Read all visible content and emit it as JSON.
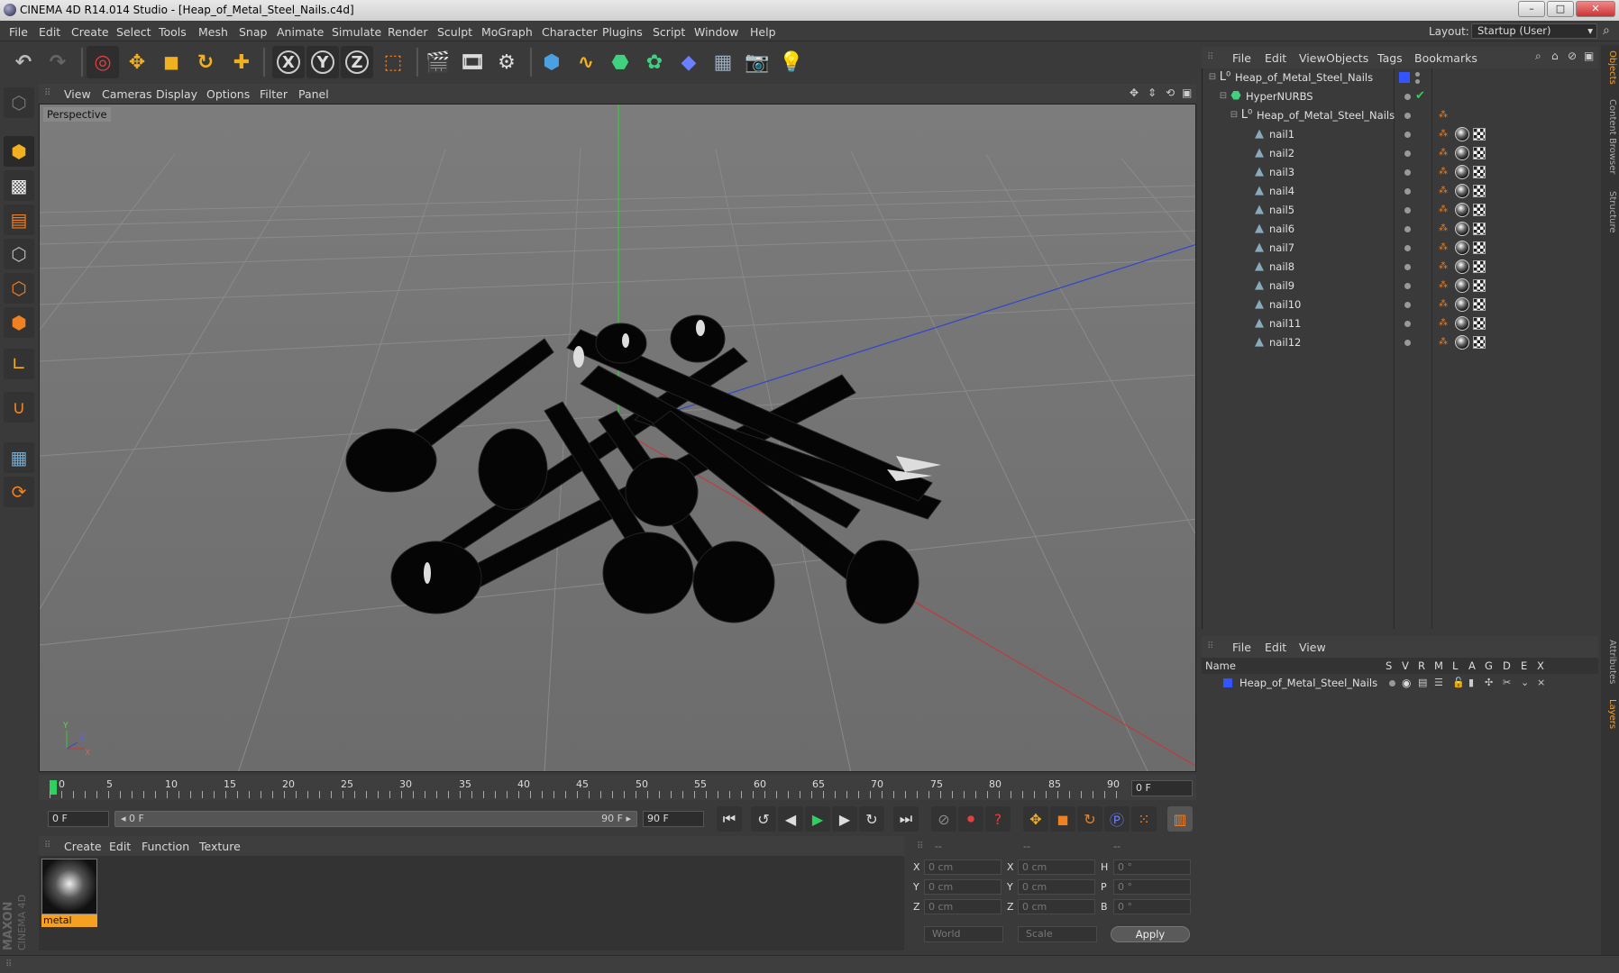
{
  "window": {
    "title": "CINEMA 4D R14.014 Studio - [Heap_of_Metal_Steel_Nails.c4d]",
    "min": "–",
    "max": "□",
    "close": "✕"
  },
  "menubar": {
    "items": [
      "File",
      "Edit",
      "Create",
      "Select",
      "Tools",
      "Mesh",
      "Snap",
      "Animate",
      "Simulate",
      "Render",
      "Sculpt",
      "MoGraph",
      "Character",
      "Plugins",
      "Script",
      "Window",
      "Help"
    ],
    "layout_label": "Layout:",
    "layout_value": "Startup (User)"
  },
  "toolbar": {
    "axis_x": "X",
    "axis_y": "Y",
    "axis_z": "Z"
  },
  "viewport": {
    "menu": [
      "View",
      "Cameras",
      "Display",
      "Options",
      "Filter",
      "Panel"
    ],
    "label": "Perspective"
  },
  "timeline": {
    "ticks": [
      "0",
      "5",
      "10",
      "15",
      "20",
      "25",
      "30",
      "35",
      "40",
      "45",
      "50",
      "55",
      "60",
      "65",
      "70",
      "75",
      "80",
      "85",
      "90"
    ],
    "current_frame": "0 F"
  },
  "transport": {
    "start_field": "0 F",
    "range_start": "◂ 0 F",
    "range_end": "90 F ▸",
    "end_field": "90 F"
  },
  "materials": {
    "menu": [
      "Create",
      "Edit",
      "Function",
      "Texture"
    ],
    "items": [
      {
        "name": "metal"
      }
    ]
  },
  "coordinates": {
    "headers": [
      "--",
      "--",
      "--"
    ],
    "rows": [
      {
        "a": "X",
        "av": "0 cm",
        "b": "X",
        "bv": "0 cm",
        "c": "H",
        "cv": "0 °"
      },
      {
        "a": "Y",
        "av": "0 cm",
        "b": "Y",
        "bv": "0 cm",
        "c": "P",
        "cv": "0 °"
      },
      {
        "a": "Z",
        "av": "0 cm",
        "b": "Z",
        "bv": "0 cm",
        "c": "B",
        "cv": "0 °"
      }
    ],
    "space": "World",
    "mode": "Scale",
    "apply": "Apply"
  },
  "object_manager": {
    "menu": [
      "File",
      "Edit",
      "View",
      "Objects",
      "Tags",
      "Bookmarks"
    ],
    "root": "Heap_of_Metal_Steel_Nails",
    "nurbs": "HyperNURBS",
    "group": "Heap_of_Metal_Steel_Nails",
    "nails": [
      "nail1",
      "nail2",
      "nail3",
      "nail4",
      "nail5",
      "nail6",
      "nail7",
      "nail8",
      "nail9",
      "nail10",
      "nail11",
      "nail12"
    ]
  },
  "layer_manager": {
    "menu": [
      "File",
      "Edit",
      "View"
    ],
    "columns": [
      "Name",
      "S",
      "V",
      "R",
      "M",
      "L",
      "A",
      "G",
      "D",
      "E",
      "X"
    ],
    "rows": [
      "Heap_of_Metal_Steel_Nails"
    ]
  },
  "right_tabs": [
    "Objects",
    "Content Browser",
    "Structure",
    "Attributes",
    "Layers"
  ],
  "brand": {
    "line1": "MAXON",
    "line2": "CINEMA 4D"
  },
  "colors": {
    "accent": "#f4a020",
    "layer_blue": "#3355ff",
    "y_axis": "#33cc33",
    "x_axis": "#cc3333",
    "z_axis": "#3344cc"
  }
}
